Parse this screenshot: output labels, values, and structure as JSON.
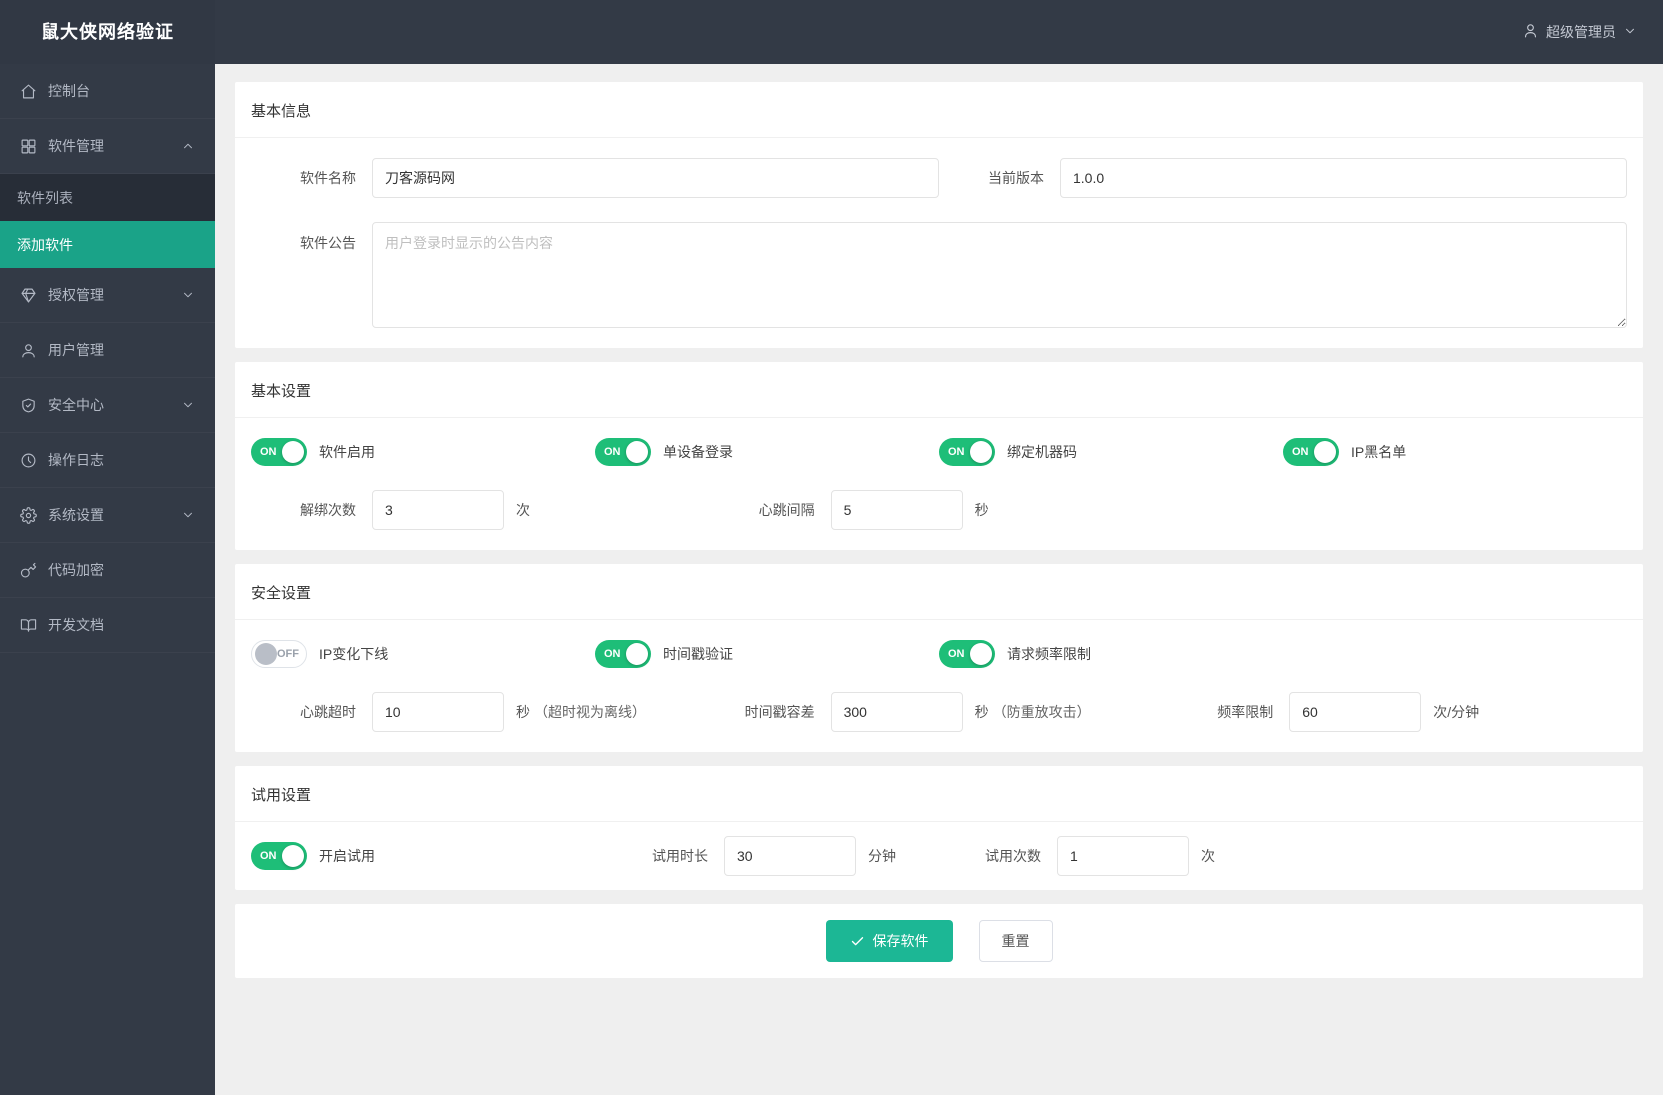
{
  "app": {
    "title": "鼠大侠网络验证"
  },
  "header": {
    "user_name": "超级管理员"
  },
  "sidebar": {
    "items": [
      {
        "label": "控制台",
        "icon": "home-icon"
      },
      {
        "label": "软件管理",
        "icon": "grid-icon",
        "expanded": true,
        "children": [
          {
            "label": "软件列表"
          },
          {
            "label": "添加软件",
            "active": true
          }
        ]
      },
      {
        "label": "授权管理",
        "icon": "diamond-icon"
      },
      {
        "label": "用户管理",
        "icon": "user-icon"
      },
      {
        "label": "安全中心",
        "icon": "shield-icon"
      },
      {
        "label": "操作日志",
        "icon": "clock-icon"
      },
      {
        "label": "系统设置",
        "icon": "gear-icon"
      },
      {
        "label": "代码加密",
        "icon": "key-icon"
      },
      {
        "label": "开发文档",
        "icon": "book-icon"
      }
    ]
  },
  "sections": {
    "basic_info": {
      "title": "基本信息",
      "software_name": {
        "label": "软件名称",
        "value": "刀客源码网"
      },
      "current_version": {
        "label": "当前版本",
        "value": "1.0.0"
      },
      "announcement": {
        "label": "软件公告",
        "placeholder": "用户登录时显示的公告内容"
      }
    },
    "basic_settings": {
      "title": "基本设置",
      "toggles": [
        {
          "label": "软件启用",
          "state": "ON"
        },
        {
          "label": "单设备登录",
          "state": "ON"
        },
        {
          "label": "绑定机器码",
          "state": "ON"
        },
        {
          "label": "IP黑名单",
          "state": "ON"
        }
      ],
      "unbind_count": {
        "label": "解绑次数",
        "value": "3",
        "unit": "次"
      },
      "heartbeat_interval": {
        "label": "心跳间隔",
        "value": "5",
        "unit": "秒"
      }
    },
    "security_settings": {
      "title": "安全设置",
      "toggles": [
        {
          "label": "IP变化下线",
          "state": "OFF"
        },
        {
          "label": "时间戳验证",
          "state": "ON"
        },
        {
          "label": "请求频率限制",
          "state": "ON"
        }
      ],
      "heartbeat_timeout": {
        "label": "心跳超时",
        "value": "10",
        "unit": "秒",
        "hint": "（超时视为离线）"
      },
      "timestamp_tolerance": {
        "label": "时间戳容差",
        "value": "300",
        "unit": "秒",
        "hint": "（防重放攻击）"
      },
      "rate_limit": {
        "label": "频率限制",
        "value": "60",
        "unit": "次/分钟"
      }
    },
    "trial_settings": {
      "title": "试用设置",
      "toggle": {
        "label": "开启试用",
        "state": "ON"
      },
      "trial_duration": {
        "label": "试用时长",
        "value": "30",
        "unit": "分钟"
      },
      "trial_count": {
        "label": "试用次数",
        "value": "1",
        "unit": "次"
      }
    },
    "actions": {
      "save_label": "保存软件",
      "reset_label": "重置"
    }
  },
  "colors": {
    "sidebar_bg": "#333a46",
    "submenu_bg": "#272d37",
    "active_item": "#1aa388",
    "toggle_on": "#1ebe78",
    "save_button": "#1cb795",
    "main_bg": "#efefef"
  }
}
